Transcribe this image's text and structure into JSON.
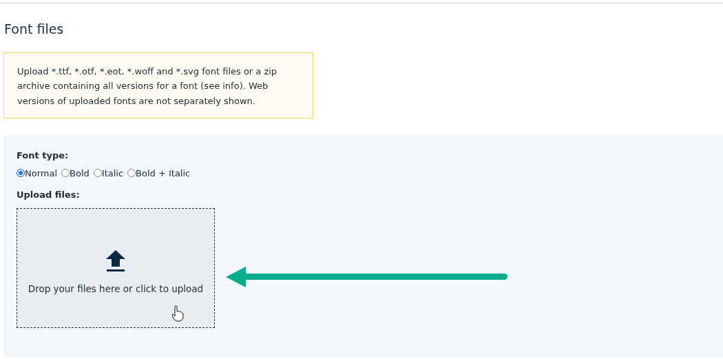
{
  "heading": "Font files",
  "info": "Upload *.ttf, *.otf, *.eot, *.woff and *.svg font files or a zip archive containing all versions for a font (see info). Web versions of uploaded fonts are not separately shown.",
  "font_type": {
    "label": "Font type:",
    "options": [
      {
        "label": "Normal",
        "selected": true
      },
      {
        "label": "Bold",
        "selected": false
      },
      {
        "label": "Italic",
        "selected": false
      },
      {
        "label": "Bold + Italic",
        "selected": false
      }
    ]
  },
  "upload": {
    "label": "Upload files:",
    "dropzone_text": "Drop your files here or click to upload"
  }
}
